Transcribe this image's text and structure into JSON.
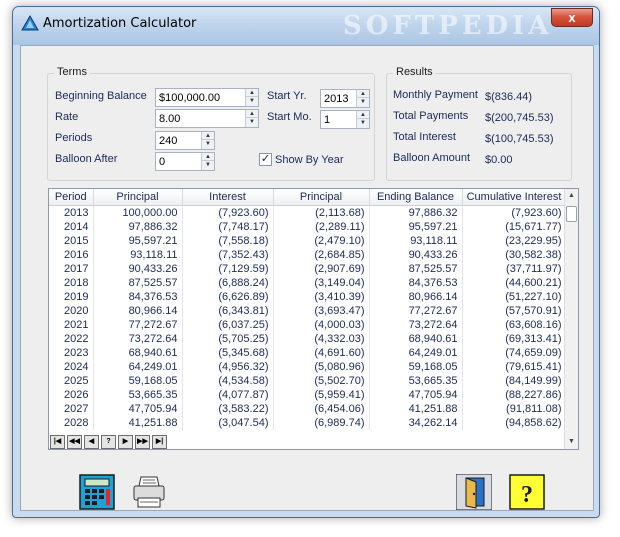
{
  "window": {
    "title": "Amortization Calculator",
    "watermark": "SOFTPEDIA",
    "close_label": "x"
  },
  "terms": {
    "group_label": "Terms",
    "beginning_balance": {
      "label": "Beginning Balance",
      "value": "$100,000.00"
    },
    "rate": {
      "label": "Rate",
      "value": "8.00"
    },
    "periods": {
      "label": "Periods",
      "value": "240"
    },
    "balloon_after": {
      "label": "Balloon After",
      "value": "0"
    },
    "start_yr": {
      "label": "Start Yr.",
      "value": "2013"
    },
    "start_mo": {
      "label": "Start Mo.",
      "value": "1"
    },
    "show_by_year": {
      "label": "Show By Year",
      "checked": true
    }
  },
  "results": {
    "group_label": "Results",
    "monthly_payment": {
      "label": "Monthly Payment",
      "value": "$(836.44)"
    },
    "total_payments": {
      "label": "Total Payments",
      "value": "$(200,745.53)"
    },
    "total_interest": {
      "label": "Total Interest",
      "value": "$(100,745.53)"
    },
    "balloon_amount": {
      "label": "Balloon Amount",
      "value": "$0.00"
    }
  },
  "table": {
    "columns": [
      "Period",
      "Principal",
      "Interest",
      "Principal",
      "Ending Balance",
      "Cumulative Interest"
    ],
    "rows": [
      [
        "2013",
        "100,000.00",
        "(7,923.60)",
        "(2,113.68)",
        "97,886.32",
        "(7,923.60)"
      ],
      [
        "2014",
        "97,886.32",
        "(7,748.17)",
        "(2,289.11)",
        "95,597.21",
        "(15,671.77)"
      ],
      [
        "2015",
        "95,597.21",
        "(7,558.18)",
        "(2,479.10)",
        "93,118.11",
        "(23,229.95)"
      ],
      [
        "2016",
        "93,118.11",
        "(7,352.43)",
        "(2,684.85)",
        "90,433.26",
        "(30,582.38)"
      ],
      [
        "2017",
        "90,433.26",
        "(7,129.59)",
        "(2,907.69)",
        "87,525.57",
        "(37,711.97)"
      ],
      [
        "2018",
        "87,525.57",
        "(6,888.24)",
        "(3,149.04)",
        "84,376.53",
        "(44,600.21)"
      ],
      [
        "2019",
        "84,376.53",
        "(6,626.89)",
        "(3,410.39)",
        "80,966.14",
        "(51,227.10)"
      ],
      [
        "2020",
        "80,966.14",
        "(6,343.81)",
        "(3,693.47)",
        "77,272.67",
        "(57,570.91)"
      ],
      [
        "2021",
        "77,272.67",
        "(6,037.25)",
        "(4,000.03)",
        "73,272.64",
        "(63,608.16)"
      ],
      [
        "2022",
        "73,272.64",
        "(5,705.25)",
        "(4,332.03)",
        "68,940.61",
        "(69,313.41)"
      ],
      [
        "2023",
        "68,940.61",
        "(5,345.68)",
        "(4,691.60)",
        "64,249.01",
        "(74,659.09)"
      ],
      [
        "2024",
        "64,249.01",
        "(4,956.32)",
        "(5,080.96)",
        "59,168.05",
        "(79,615.41)"
      ],
      [
        "2025",
        "59,168.05",
        "(4,534.58)",
        "(5,502.70)",
        "53,665.35",
        "(84,149.99)"
      ],
      [
        "2026",
        "53,665.35",
        "(4,077.87)",
        "(5,959.41)",
        "47,705.94",
        "(88,227.86)"
      ],
      [
        "2027",
        "47,705.94",
        "(3,583.22)",
        "(6,454.06)",
        "41,251.88",
        "(91,811.08)"
      ],
      [
        "2028",
        "41,251.88",
        "(3,047.54)",
        "(6,989.74)",
        "34,262.14",
        "(94,858.62)"
      ]
    ]
  },
  "navigator": [
    "|◀",
    "◀◀",
    "◀",
    "?",
    "▶",
    "▶▶",
    "▶|"
  ],
  "icons": {
    "app": "triangle-icon",
    "calculator": "calculator-icon",
    "print": "printer-icon",
    "exit": "exit-door-icon",
    "help": "help-icon"
  },
  "colors": {
    "accent": "#1b2a57",
    "help_bg": "#ffff33",
    "calc_bg": "#1fa0d8"
  }
}
